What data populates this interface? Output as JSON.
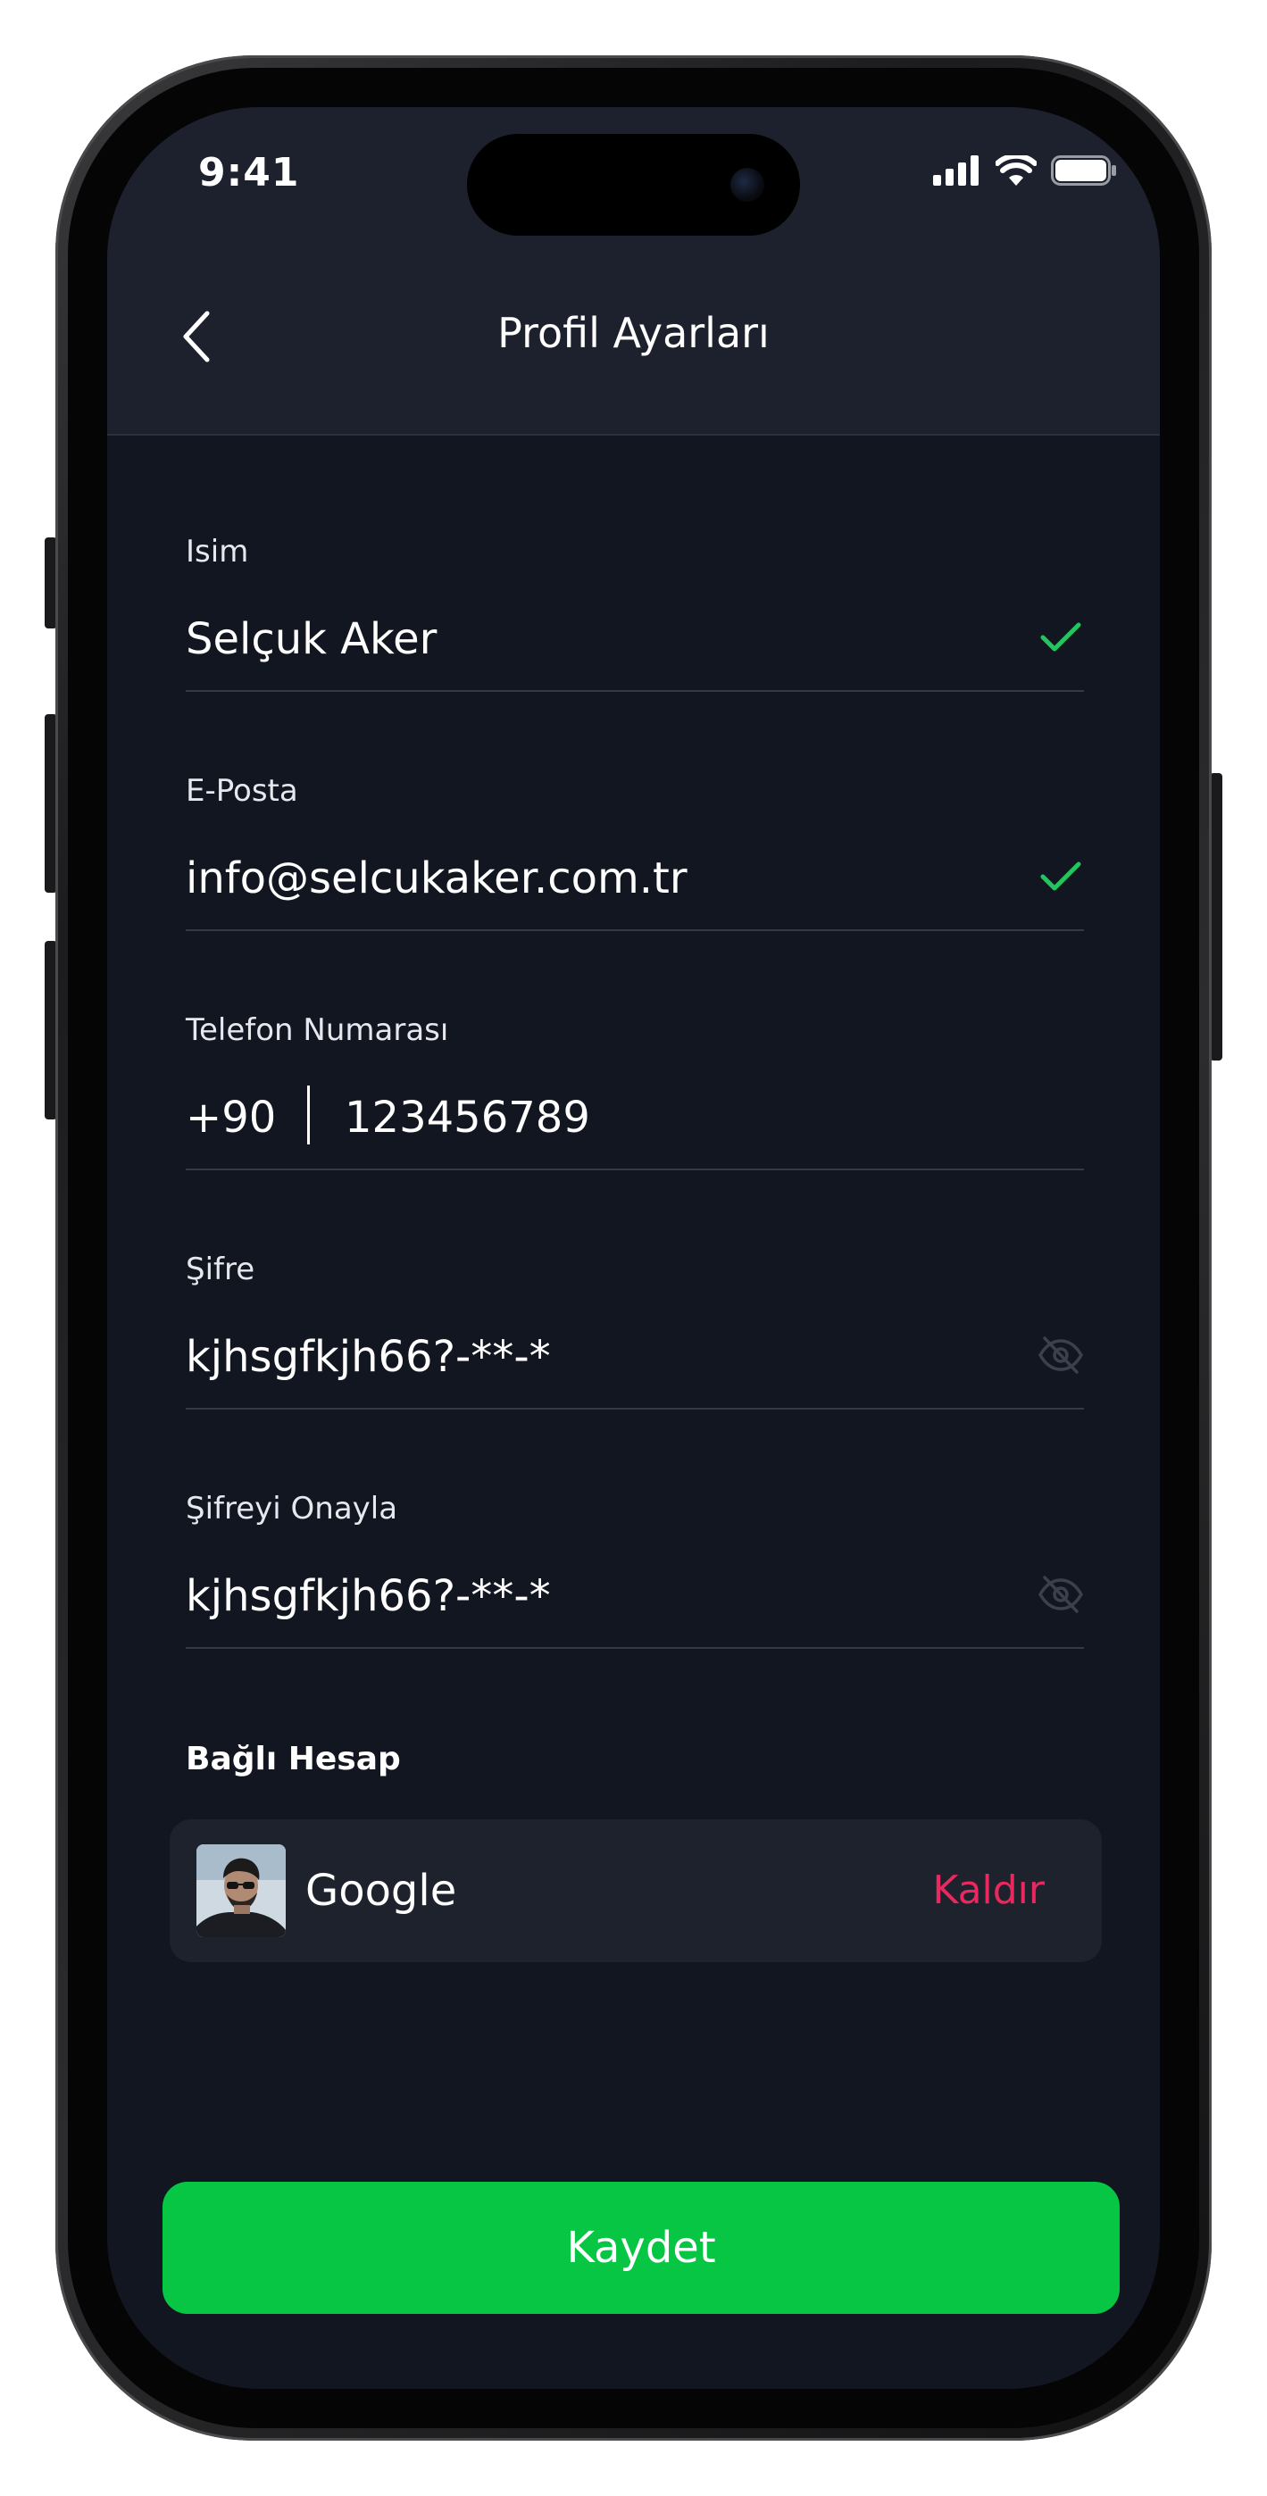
{
  "status_bar": {
    "time": "9:41",
    "icons": [
      "cellular-signal-icon",
      "wifi-icon",
      "battery-icon"
    ]
  },
  "header": {
    "title": "Profil Ayarları",
    "back_icon": "chevron-left-icon"
  },
  "form": {
    "name": {
      "label": "Isim",
      "value": "Selçuk Aker",
      "status_icon": "check-icon"
    },
    "email": {
      "label": "E-Posta",
      "value": "info@selcukaker.com.tr",
      "status_icon": "check-icon"
    },
    "phone": {
      "label": "Telefon Numarası",
      "country_code": "+90",
      "number": "123456789"
    },
    "password": {
      "label": "Şifre",
      "value": "kjhsgfkjh66?-**-*",
      "toggle_icon": "eye-off-icon"
    },
    "password_confirm": {
      "label": "Şifreyi Onayla",
      "value": "kjhsgfkjh66?-**-*",
      "toggle_icon": "eye-off-icon"
    }
  },
  "linked_account": {
    "section_title": "Bağlı Hesap",
    "provider": "Google",
    "remove_label": "Kaldır"
  },
  "actions": {
    "save_label": "Kaydet"
  },
  "colors": {
    "background": "#121620",
    "header_background": "#1d212d",
    "accent_green": "#06c643",
    "check_green": "#22c55e",
    "remove_red": "#e8285e",
    "divider": "#343946"
  }
}
